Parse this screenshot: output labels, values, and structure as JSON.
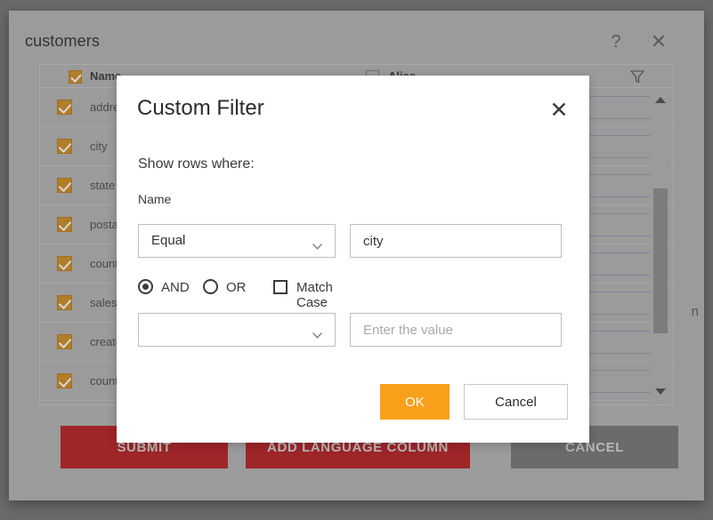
{
  "window": {
    "title": "customers",
    "help_icon": "question-mark-icon",
    "close_icon": "close-icon"
  },
  "mapping_panel": {
    "columns": [
      "Name",
      "Alias"
    ],
    "filter_icon": "funnel-filter-icon",
    "header_checkbox_name_checked": true,
    "header_checkbox_alias_checked": false,
    "rows": [
      {
        "name": "address",
        "alias": ""
      },
      {
        "name": "city",
        "alias": ""
      },
      {
        "name": "state",
        "alias": ""
      },
      {
        "name": "postal_code",
        "alias": ""
      },
      {
        "name": "country",
        "alias": ""
      },
      {
        "name": "sales_rep",
        "alias": ""
      },
      {
        "name": "created_at",
        "alias": ""
      },
      {
        "name": "country_code",
        "alias": ""
      }
    ],
    "scroll_up_icon": "caret-up-icon",
    "scroll_down_icon": "caret-down-icon"
  },
  "actions": {
    "submit_label": "SUBMIT",
    "add_language_column_label": "ADD LANGUAGE COLUMN",
    "cancel_label": "CANCEL"
  },
  "side_note": "n",
  "dialog": {
    "title": "Custom Filter",
    "close_icon": "close-icon",
    "show_rows_label": "Show rows where:",
    "field_label": "Name",
    "condition_1": {
      "operator": "Equal",
      "value": "city",
      "chevron_icon": "chevron-down-icon"
    },
    "logic": {
      "and_label": "AND",
      "or_label": "OR",
      "selected": "AND",
      "match_case_label": "Match Case",
      "match_case_checked": false
    },
    "condition_2": {
      "operator": "",
      "value": "",
      "value_placeholder": "Enter the value",
      "chevron_icon": "chevron-down-icon"
    },
    "ok_label": "OK",
    "cancel_label": "Cancel"
  },
  "colors": {
    "accent_orange": "#f9a01b",
    "checkbox_amber": "#b07d28",
    "action_red": "#9e2528",
    "action_gray": "#6b6b6b",
    "overlay_gray": "#9b9b9b"
  }
}
